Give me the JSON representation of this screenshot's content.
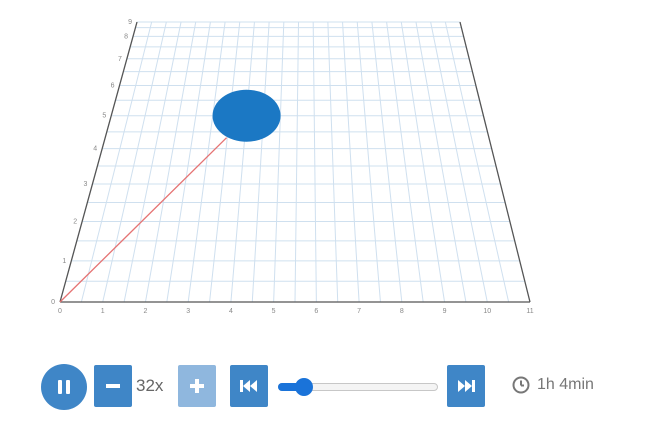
{
  "scene": {
    "x_ticks": [
      "0",
      "1",
      "2",
      "3",
      "4",
      "5",
      "6",
      "7",
      "8",
      "9",
      "10",
      "11"
    ],
    "y_ticks": [
      "0",
      "1",
      "2",
      "3",
      "4",
      "5",
      "6",
      "7",
      "8",
      "9"
    ],
    "grid_color": "#cfe0ef",
    "axis_color": "#555555",
    "trail_color": "#e57373",
    "ball_color": "#1b78c4",
    "ball_position": {
      "x": 4,
      "y": 5
    }
  },
  "controls": {
    "speed_label": "32x",
    "progress_fraction": 0.16,
    "duration_label": "1h 4min",
    "accent_color": "#3f86c7"
  }
}
